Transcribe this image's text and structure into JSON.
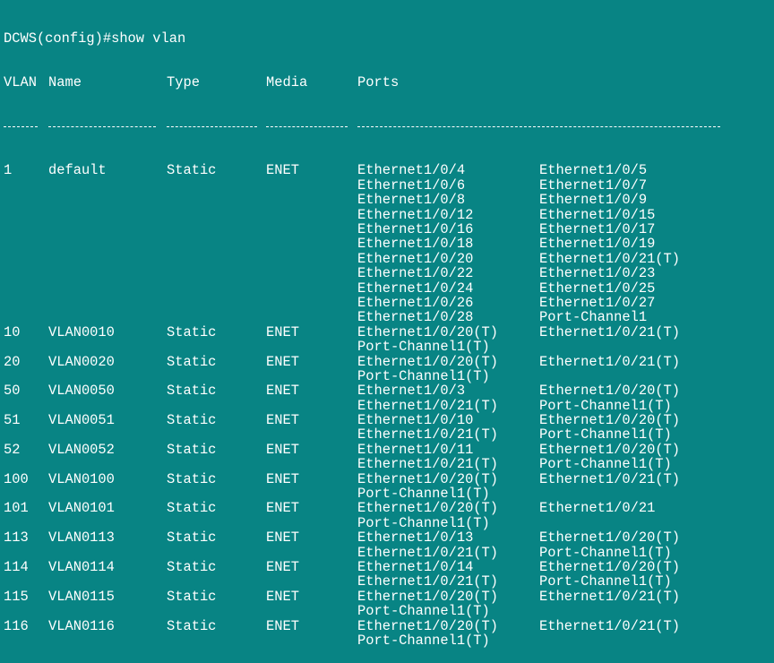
{
  "terminal": {
    "prompt": "DCWS(config)#",
    "command": "show vlan"
  },
  "headers": {
    "vlan": "VLAN",
    "name": "Name",
    "type": "Type",
    "media": "Media",
    "ports": "Ports"
  },
  "rows": [
    {
      "vlan": "1",
      "name": "default",
      "type": "Static",
      "media": "ENET",
      "ports": [
        [
          "Ethernet1/0/4",
          "Ethernet1/0/5"
        ],
        [
          "Ethernet1/0/6",
          "Ethernet1/0/7"
        ],
        [
          "Ethernet1/0/8",
          "Ethernet1/0/9"
        ],
        [
          "Ethernet1/0/12",
          "Ethernet1/0/15"
        ],
        [
          "Ethernet1/0/16",
          "Ethernet1/0/17"
        ],
        [
          "Ethernet1/0/18",
          "Ethernet1/0/19"
        ],
        [
          "Ethernet1/0/20",
          "Ethernet1/0/21(T)"
        ],
        [
          "Ethernet1/0/22",
          "Ethernet1/0/23"
        ],
        [
          "Ethernet1/0/24",
          "Ethernet1/0/25"
        ],
        [
          "Ethernet1/0/26",
          "Ethernet1/0/27"
        ],
        [
          "Ethernet1/0/28",
          "Port-Channel1"
        ]
      ]
    },
    {
      "vlan": "10",
      "name": "VLAN0010",
      "type": "Static",
      "media": "ENET",
      "ports": [
        [
          "Ethernet1/0/20(T)",
          "Ethernet1/0/21(T)"
        ],
        [
          "Port-Channel1(T)",
          ""
        ]
      ]
    },
    {
      "vlan": "20",
      "name": "VLAN0020",
      "type": "Static",
      "media": "ENET",
      "ports": [
        [
          "Ethernet1/0/20(T)",
          "Ethernet1/0/21(T)"
        ],
        [
          "Port-Channel1(T)",
          ""
        ]
      ]
    },
    {
      "vlan": "50",
      "name": "VLAN0050",
      "type": "Static",
      "media": "ENET",
      "ports": [
        [
          "Ethernet1/0/3",
          "Ethernet1/0/20(T)"
        ],
        [
          "Ethernet1/0/21(T)",
          "Port-Channel1(T)"
        ]
      ]
    },
    {
      "vlan": "51",
      "name": "VLAN0051",
      "type": "Static",
      "media": "ENET",
      "ports": [
        [
          "Ethernet1/0/10",
          "Ethernet1/0/20(T)"
        ],
        [
          "Ethernet1/0/21(T)",
          "Port-Channel1(T)"
        ]
      ]
    },
    {
      "vlan": "52",
      "name": "VLAN0052",
      "type": "Static",
      "media": "ENET",
      "ports": [
        [
          "Ethernet1/0/11",
          "Ethernet1/0/20(T)"
        ],
        [
          "Ethernet1/0/21(T)",
          "Port-Channel1(T)"
        ]
      ]
    },
    {
      "vlan": "100",
      "name": "VLAN0100",
      "type": "Static",
      "media": "ENET",
      "ports": [
        [
          "Ethernet1/0/20(T)",
          "Ethernet1/0/21(T)"
        ],
        [
          "Port-Channel1(T)",
          ""
        ]
      ]
    },
    {
      "vlan": "101",
      "name": "VLAN0101",
      "type": "Static",
      "media": "ENET",
      "ports": [
        [
          "Ethernet1/0/20(T)",
          "Ethernet1/0/21"
        ],
        [
          "Port-Channel1(T)",
          ""
        ]
      ]
    },
    {
      "vlan": "113",
      "name": "VLAN0113",
      "type": "Static",
      "media": "ENET",
      "ports": [
        [
          "Ethernet1/0/13",
          "Ethernet1/0/20(T)"
        ],
        [
          "Ethernet1/0/21(T)",
          "Port-Channel1(T)"
        ]
      ]
    },
    {
      "vlan": "114",
      "name": "VLAN0114",
      "type": "Static",
      "media": "ENET",
      "ports": [
        [
          "Ethernet1/0/14",
          "Ethernet1/0/20(T)"
        ],
        [
          "Ethernet1/0/21(T)",
          "Port-Channel1(T)"
        ]
      ]
    },
    {
      "vlan": "115",
      "name": "VLAN0115",
      "type": "Static",
      "media": "ENET",
      "ports": [
        [
          "Ethernet1/0/20(T)",
          "Ethernet1/0/21(T)"
        ],
        [
          "Port-Channel1(T)",
          ""
        ]
      ]
    },
    {
      "vlan": "116",
      "name": "VLAN0116",
      "type": "Static",
      "media": "ENET",
      "ports": [
        [
          "Ethernet1/0/20(T)",
          "Ethernet1/0/21(T)"
        ],
        [
          "Port-Channel1(T)",
          ""
        ]
      ]
    }
  ],
  "colors": {
    "background": "#088484",
    "text": "#ffffff"
  }
}
